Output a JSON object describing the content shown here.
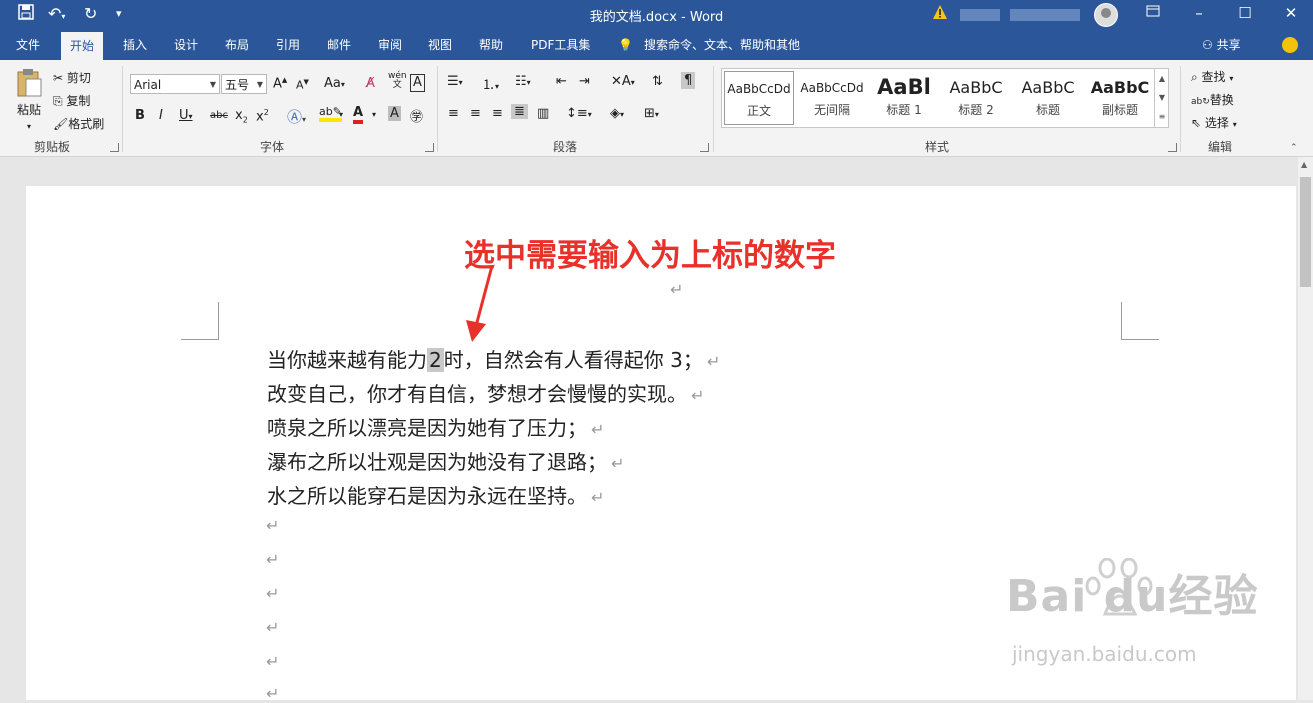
{
  "window": {
    "title": "我的文档.docx  -  Word",
    "controls": [
      "restore-ribbon",
      "minimize",
      "maximize",
      "close"
    ]
  },
  "tabs": [
    {
      "label": "文件"
    },
    {
      "label": "开始",
      "active": true
    },
    {
      "label": "插入"
    },
    {
      "label": "设计"
    },
    {
      "label": "布局"
    },
    {
      "label": "引用"
    },
    {
      "label": "邮件"
    },
    {
      "label": "审阅"
    },
    {
      "label": "视图"
    },
    {
      "label": "帮助"
    },
    {
      "label": "PDF工具集"
    }
  ],
  "search_hint": "搜索命令、文本、帮助和其他",
  "share_label": "共享",
  "ribbon": {
    "clipboard": {
      "paste": "粘贴",
      "cut": "剪切",
      "copy": "复制",
      "format_painter": "格式刷",
      "group": "剪贴板"
    },
    "font": {
      "font_name": "Arial",
      "font_size": "五号",
      "group": "字体",
      "case_label": "Aa",
      "pinyin": "wén"
    },
    "paragraph": {
      "group": "段落"
    },
    "styles": {
      "group": "样式",
      "items": [
        {
          "sample": "AaBbCcDd",
          "name": "正文"
        },
        {
          "sample": "AaBbCcDd",
          "name": "无间隔"
        },
        {
          "sample": "AaBl",
          "name": "标题 1"
        },
        {
          "sample": "AaBbC",
          "name": "标题 2"
        },
        {
          "sample": "AaBbC",
          "name": "标题"
        },
        {
          "sample": "AaBbC",
          "name": "副标题"
        }
      ]
    },
    "editing": {
      "find": "查找",
      "replace": "替换",
      "select": "选择",
      "group": "编辑"
    }
  },
  "document": {
    "annotation": "选中需要输入为上标的数字",
    "paragraphs": [
      {
        "before": "当你越来越有能力",
        "selected": "2",
        "after": "时，自然会有人看得起你 3；"
      },
      {
        "text": "改变自己，你才有自信，梦想才会慢慢的实现。"
      },
      {
        "text": "喷泉之所以漂亮是因为她有了压力；"
      },
      {
        "text": "瀑布之所以壮观是因为她没有了退路；"
      },
      {
        "text": "水之所以能穿石是因为永远在坚持。"
      }
    ],
    "paragraph_mark": "↵"
  },
  "watermark": {
    "brand": "Bai  du经验",
    "url": "jingyan.baidu.com"
  },
  "colors": {
    "titlebar": "#2b579a",
    "annotation": "#e8312a",
    "selection": "#c8c8c8"
  }
}
